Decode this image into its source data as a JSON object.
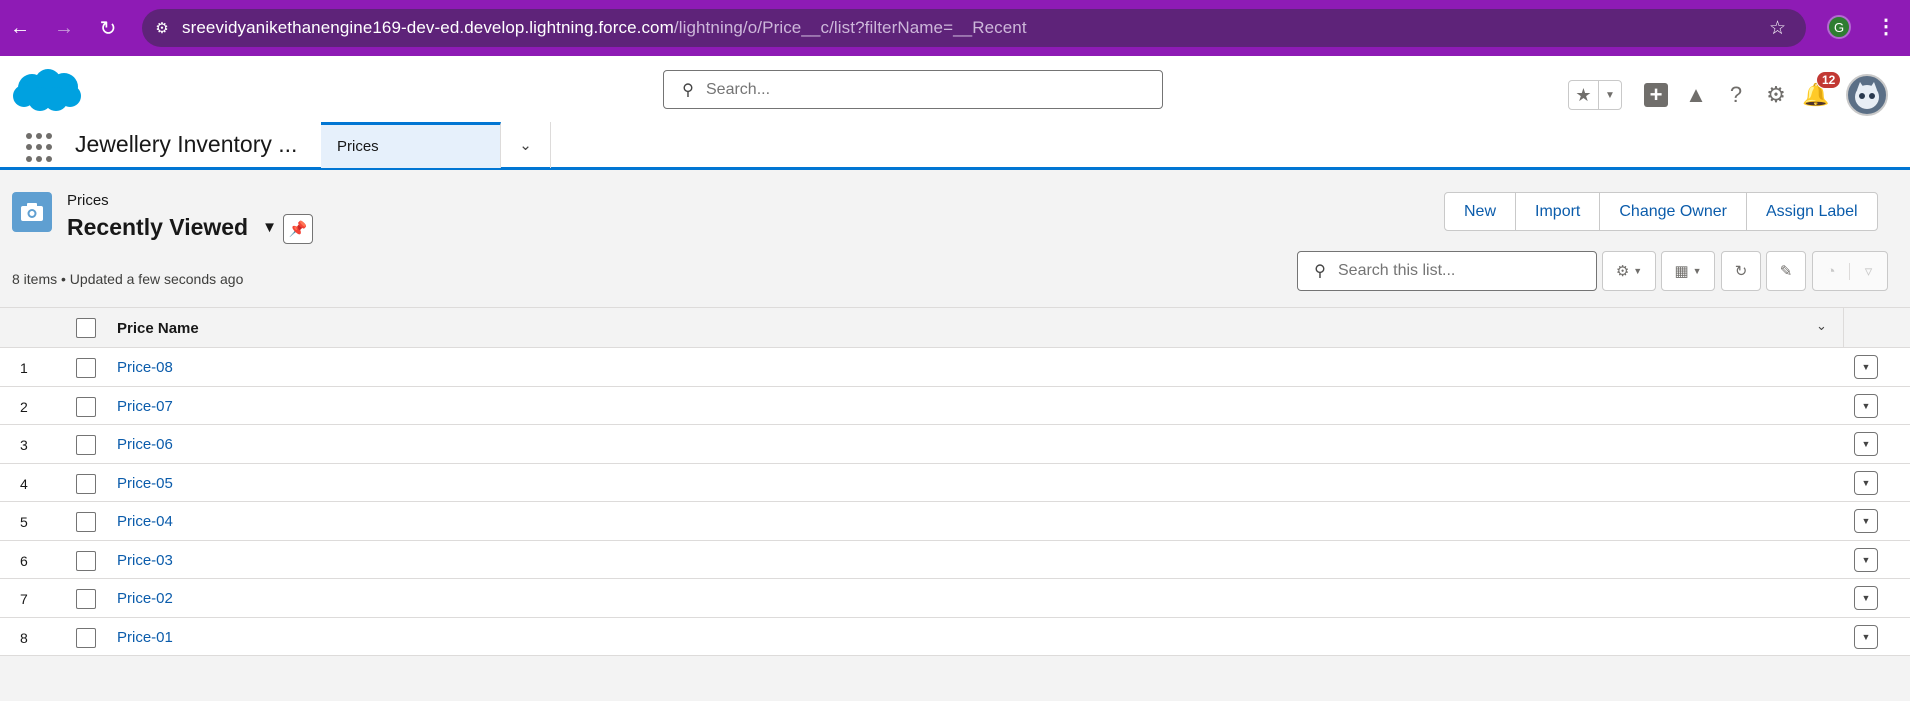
{
  "browser": {
    "url_host": "sreevidyanikethanengine169-dev-ed.develop.lightning.force.com",
    "url_path": "/lightning/o/Price__c/list?filterName=__Recent",
    "profile_initial": "G"
  },
  "header": {
    "search_placeholder": "Search...",
    "notification_count": "12"
  },
  "appnav": {
    "app_name": "Jewellery Inventory ...",
    "active_tab": "Prices"
  },
  "listview": {
    "object_label": "Prices",
    "view_name": "Recently Viewed",
    "meta": "8 items • Updated a few seconds ago",
    "search_placeholder": "Search this list...",
    "buttons": {
      "new": "New",
      "import": "Import",
      "change_owner": "Change Owner",
      "assign_label": "Assign Label"
    }
  },
  "table": {
    "column_header": "Price Name",
    "rows": [
      {
        "num": "1",
        "name": "Price-08"
      },
      {
        "num": "2",
        "name": "Price-07"
      },
      {
        "num": "3",
        "name": "Price-06"
      },
      {
        "num": "4",
        "name": "Price-05"
      },
      {
        "num": "5",
        "name": "Price-04"
      },
      {
        "num": "6",
        "name": "Price-03"
      },
      {
        "num": "7",
        "name": "Price-02"
      },
      {
        "num": "8",
        "name": "Price-01"
      }
    ]
  },
  "colors": {
    "browser_frame": "#8e1bb5",
    "brand_blue": "#0176d3",
    "link": "#0b5cab",
    "notification_badge": "#c23934"
  }
}
